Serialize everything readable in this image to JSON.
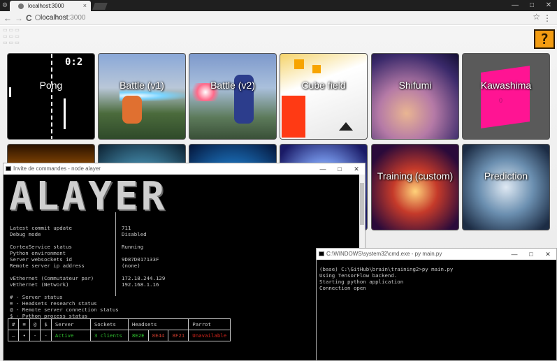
{
  "browser": {
    "tab_title": "localhost:3000",
    "tab_close": "×",
    "url_host": "localhost",
    "url_port": ":3000",
    "back": "←",
    "forward": "→",
    "reload": "C",
    "star": "☆",
    "menu": "⋮",
    "win_min": "—",
    "win_max": "□",
    "win_close": "✕"
  },
  "page": {
    "question_block": "?",
    "tiles": [
      {
        "label": "Pong"
      },
      {
        "label": "Battle (v1)"
      },
      {
        "label": "Battle (v2)"
      },
      {
        "label": "Cube field"
      },
      {
        "label": "Shifumi"
      },
      {
        "label": "Kawashima"
      },
      {
        "label": ""
      },
      {
        "label": ""
      },
      {
        "label": ""
      },
      {
        "label": ""
      },
      {
        "label": "Training (custom)"
      },
      {
        "label": "Prediction"
      }
    ],
    "pong_score": "0:2",
    "kawashima_face": "0"
  },
  "cmd1": {
    "title": "Invite de commandes - node  alayer",
    "logo": "ALAYER",
    "rows": [
      {
        "k": "Latest commit update",
        "v": "711"
      },
      {
        "k": "Debug mode",
        "v": "Disabled"
      },
      {
        "k": "CortexService status",
        "v": "Running"
      },
      {
        "k": "Python environment",
        "v": ""
      },
      {
        "k": "Server websockets id",
        "v": "9D87D017133F"
      },
      {
        "k": "Remote server ip address",
        "v": "(none)"
      },
      {
        "k": "vEthernet (Commutateur par)",
        "v": "172.18.244.129"
      },
      {
        "k": "vEthernet (Network)",
        "v": "192.168.1.16"
      }
    ],
    "legend": [
      "# - Server status",
      "≡ - Headsets research status",
      "@ - Remote server connection status",
      "$ - Python process status"
    ],
    "table_headers": [
      "#",
      "≡",
      "@",
      "$",
      "Server",
      "Sockets",
      "Headsets",
      "Parrot"
    ],
    "table_row": [
      "—",
      "•",
      "-",
      "-",
      "Active",
      "3 clients",
      "8E2E",
      "8E44",
      "8F21",
      "Unavailable"
    ]
  },
  "cmd2": {
    "title": "C:\\WINDOWS\\system32\\cmd.exe - py  main.py",
    "lines": [
      "(base) C:\\GitHub\\brain\\training2>py main.py",
      "Using TensorFlow backend.",
      "Starting python application",
      "Connection open"
    ]
  },
  "colors": {
    "active_green": "#2fbf2f",
    "headset_red": "#c0392b",
    "unavailable_red": "#d9261c"
  }
}
